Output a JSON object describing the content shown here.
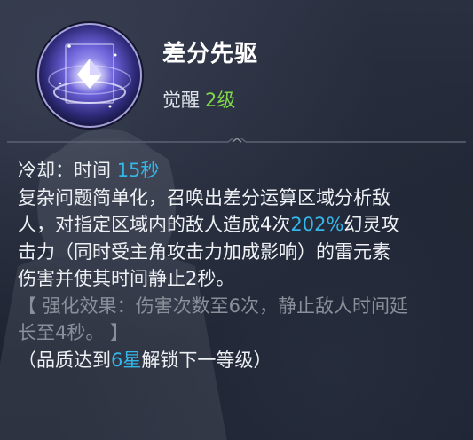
{
  "skill": {
    "name": "差分先驱",
    "awaken_label": "觉醒",
    "awaken_level": "2级"
  },
  "cooldown": {
    "label": "冷却：时间",
    "value": "15秒"
  },
  "description": {
    "line1": "复杂问题简单化，召唤出差分运算区域分析敌",
    "line2_a": "人，对指定区域内的敌人造成4次",
    "line2_pct": "202%",
    "line2_b": "幻灵攻",
    "line3": "击力（同时受主角攻击力加成影响）的雷元素",
    "line4": "伤害并使其时间静止2秒。"
  },
  "enhance": {
    "line1": "【 强化效果：伤害次数至6次，静止敌人时间延",
    "line2": "长至4秒。 】"
  },
  "unlock": {
    "prefix": "（品质达到",
    "stars": "6星",
    "suffix": "解锁下一等级）"
  },
  "colors": {
    "highlight": "#35b6e8",
    "level_green": "#7fd94a",
    "dim_text": "#8a8f99"
  },
  "icon": "crystal-orb-icon"
}
